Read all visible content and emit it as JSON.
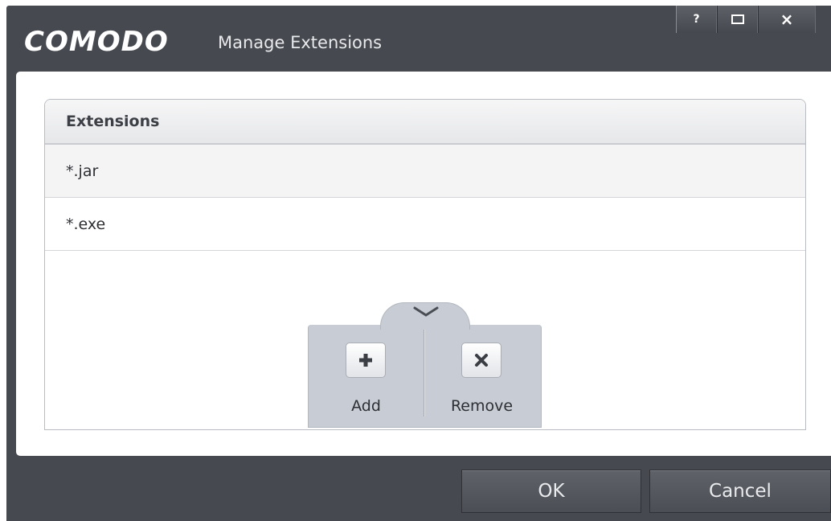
{
  "window": {
    "brand": "COMODO",
    "title": "Manage Extensions",
    "controls": {
      "help": "?",
      "close": "×"
    }
  },
  "table": {
    "header": "Extensions",
    "rows": [
      "*.jar",
      "*.exe"
    ]
  },
  "toolbar": {
    "add_label": "Add",
    "remove_label": "Remove"
  },
  "dialog_buttons": {
    "ok_label": "OK",
    "cancel_label": "Cancel"
  },
  "icons": [
    "chevron-down-icon",
    "plus-icon",
    "close-x-icon",
    "help-icon",
    "maximize-icon",
    "close-icon"
  ]
}
